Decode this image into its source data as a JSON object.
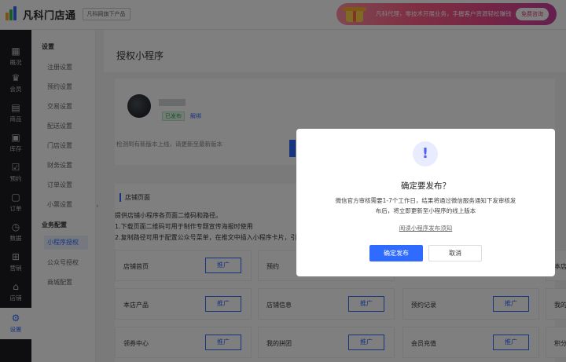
{
  "header": {
    "logo_text": "凡科门店通",
    "logo_sub": "凡科网旗下产品",
    "banner_text": "凡科代理，零技术开展业务，手握客户资源轻松赚钱",
    "banner_button": "免费咨询"
  },
  "leftnav": {
    "items": [
      {
        "label": "概况",
        "icon": "dashboard-icon"
      },
      {
        "label": "会员",
        "icon": "member-icon"
      },
      {
        "label": "商品",
        "icon": "goods-icon"
      },
      {
        "label": "库存",
        "icon": "inventory-icon"
      },
      {
        "label": "预约",
        "icon": "booking-icon"
      },
      {
        "label": "订单",
        "icon": "order-icon"
      },
      {
        "label": "数据",
        "icon": "data-icon"
      },
      {
        "label": "营销",
        "icon": "marketing-icon"
      },
      {
        "label": "店铺",
        "icon": "shop-icon"
      },
      {
        "label": "设置",
        "icon": "settings-icon"
      }
    ]
  },
  "subnav": {
    "group1": "设置",
    "items1": [
      "注册设置",
      "预约设置",
      "交易设置",
      "配送设置",
      "门店设置",
      "财务设置",
      "订单设置",
      "小票设置"
    ],
    "group2": "业务配置",
    "items2": [
      "小程序授权",
      "公众号授权",
      "商城配置"
    ]
  },
  "main": {
    "title": "授权小程序",
    "status": "已发布",
    "unbind": "解绑",
    "version_tip": "检测到有新版本上线，请更新至最新版本",
    "section_title": "店铺页面",
    "desc_lines": [
      "提供店铺小程序各页面二维码和路径。",
      "1.下载页面二维码可用于制作专题宣传海报时使用",
      "2.复制路径可用于配置公众号菜单，在推文中插入小程序卡片，引"
    ],
    "promote_label": "推广",
    "grid": [
      [
        "店铺首页",
        "预约",
        "",
        "本店"
      ],
      [
        "本店产品",
        "店铺信息",
        "预约记录",
        "我的"
      ],
      [
        "领券中心",
        "我的拼团",
        "会员充值",
        "积分"
      ]
    ]
  },
  "modal": {
    "icon": "!",
    "title": "确定要发布？",
    "text": "微信官方审核需要1-7个工作日，结果将通过微信服务通知下发审核发布后，将立即更新至小程序的线上版本",
    "link": "阅读小程序发布须知",
    "confirm": "确定发布",
    "cancel": "取消"
  },
  "colors": {
    "primary": "#2f6bff",
    "nav_bg": "#1c1d21",
    "overlay": "rgba(0,0,0,0.5)",
    "success": "#27a74a"
  }
}
